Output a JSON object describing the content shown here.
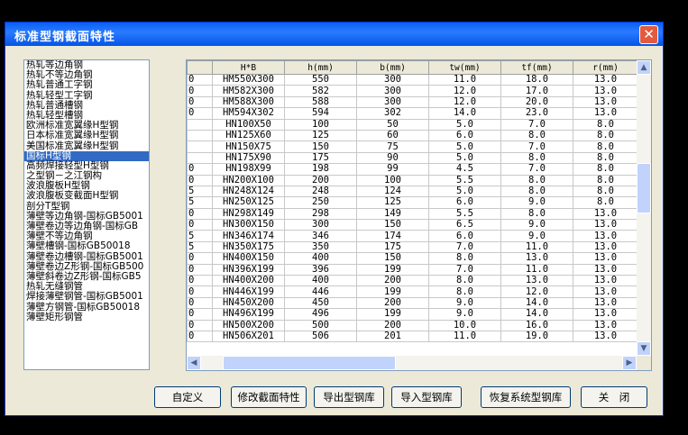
{
  "window": {
    "title": "标准型钢截面特性",
    "close_label": "✕"
  },
  "list": {
    "items": [
      "热轧等边角钢",
      "热轧不等边角钢",
      "热轧普通工字钢",
      "热轧轻型工字钢",
      "热轧普通槽钢",
      "热轧轻型槽钢",
      "欧洲标准宽翼缘H型钢",
      "日本标准宽翼缘H型钢",
      "美国标准宽翼缘H型钢",
      "国标H型钢",
      "高频焊接轻型H型钢",
      "之型钢－之江钢构",
      "波浪腹板H型钢",
      "波浪腹板变截面H型钢",
      "剖分T型钢",
      "薄壁等边角钢-国标GB5001",
      "薄壁卷边等边角钢-国标GB",
      "薄壁不等边角钢",
      "薄壁槽钢-国标GB50018",
      "薄壁卷边槽钢-国标GB5001",
      "薄壁卷边Z形钢-国标GB500",
      "薄壁斜卷边Z形钢-国标GB5",
      "热轧无缝钢管",
      "焊接薄壁钢管-国标GB5001",
      "薄壁方钢管-国标GB50018",
      "薄壁矩形钢管"
    ],
    "selected_index": 9
  },
  "table": {
    "headers": [
      "",
      "H*B",
      "h(mm)",
      "b(mm)",
      "tw(mm)",
      "tf(mm)",
      "r(mm)"
    ],
    "rows": [
      [
        "0",
        "HM550X300",
        "550",
        "300",
        "11.0",
        "18.0",
        "13.0"
      ],
      [
        "0",
        "HM582X300",
        "582",
        "300",
        "12.0",
        "17.0",
        "13.0"
      ],
      [
        "0",
        "HM588X300",
        "588",
        "300",
        "12.0",
        "20.0",
        "13.0"
      ],
      [
        "0",
        "HM594X302",
        "594",
        "302",
        "14.0",
        "23.0",
        "13.0"
      ],
      [
        "",
        "HN100X50",
        "100",
        "50",
        "5.0",
        "7.0",
        "8.0"
      ],
      [
        "",
        "HN125X60",
        "125",
        "60",
        "6.0",
        "8.0",
        "8.0"
      ],
      [
        "",
        "HN150X75",
        "150",
        "75",
        "5.0",
        "7.0",
        "8.0"
      ],
      [
        "",
        "HN175X90",
        "175",
        "90",
        "5.0",
        "8.0",
        "8.0"
      ],
      [
        "0",
        "HN198X99",
        "198",
        "99",
        "4.5",
        "7.0",
        "8.0"
      ],
      [
        "0",
        "HN200X100",
        "200",
        "100",
        "5.5",
        "8.0",
        "8.0"
      ],
      [
        "5",
        "HN248X124",
        "248",
        "124",
        "5.0",
        "8.0",
        "8.0"
      ],
      [
        "5",
        "HN250X125",
        "250",
        "125",
        "6.0",
        "9.0",
        "8.0"
      ],
      [
        "0",
        "HN298X149",
        "298",
        "149",
        "5.5",
        "8.0",
        "13.0"
      ],
      [
        "0",
        "HN300X150",
        "300",
        "150",
        "6.5",
        "9.0",
        "13.0"
      ],
      [
        "5",
        "HN346X174",
        "346",
        "174",
        "6.0",
        "9.0",
        "13.0"
      ],
      [
        "5",
        "HN350X175",
        "350",
        "175",
        "7.0",
        "11.0",
        "13.0"
      ],
      [
        "0",
        "HN400X150",
        "400",
        "150",
        "8.0",
        "13.0",
        "13.0"
      ],
      [
        "0",
        "HN396X199",
        "396",
        "199",
        "7.0",
        "11.0",
        "13.0"
      ],
      [
        "0",
        "HN400X200",
        "400",
        "200",
        "8.0",
        "13.0",
        "13.0"
      ],
      [
        "0",
        "HN446X199",
        "446",
        "199",
        "8.0",
        "12.0",
        "13.0"
      ],
      [
        "0",
        "HN450X200",
        "450",
        "200",
        "9.0",
        "14.0",
        "13.0"
      ],
      [
        "0",
        "HN496X199",
        "496",
        "199",
        "9.0",
        "14.0",
        "13.0"
      ],
      [
        "0",
        "HN500X200",
        "500",
        "200",
        "10.0",
        "16.0",
        "13.0"
      ],
      [
        "0",
        "HN506X201",
        "506",
        "201",
        "11.0",
        "19.0",
        "13.0"
      ]
    ]
  },
  "buttons": {
    "custom": "自定义",
    "modify": "修改截面特性",
    "export": "导出型钢库",
    "import": "导入型钢库",
    "restore": "恢复系统型钢库",
    "close": "关　闭"
  }
}
